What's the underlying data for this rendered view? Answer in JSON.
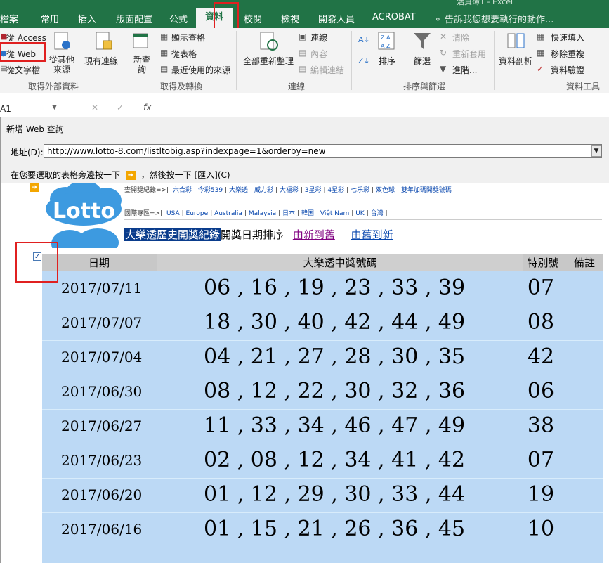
{
  "window": {
    "title_partial": "活頁簿1 - Excel"
  },
  "ribbon_tabs": [
    "檔案",
    "常用",
    "插入",
    "版面配置",
    "公式",
    "資料",
    "校閱",
    "檢視",
    "開發人員",
    "ACROBAT"
  ],
  "tell_me": "告訴我您想要執行的動作...",
  "ribbon": {
    "from_access": "從 Access",
    "from_web": "從 Web",
    "from_text": "從文字檔",
    "from_other": "從其他\n來源",
    "existing_connections": "現有連線",
    "get_external_group": "取得外部資料",
    "new_query": "新查\n詢",
    "show_queries": "顯示查格",
    "from_table": "從表格",
    "recent_sources": "最近使用的來源",
    "get_transform_group": "取得及轉換",
    "refresh_all": "全部重新整理",
    "connections": "連線",
    "properties": "內容",
    "edit_links": "編輯連結",
    "connections_group": "連線",
    "sort": "排序",
    "filter": "篩選",
    "clear": "清除",
    "reapply": "重新套用",
    "advanced": "進階...",
    "sort_filter_group": "排序與篩選",
    "text_to_columns": "資料剖析",
    "flash_fill": "快速填入",
    "remove_duplicates": "移除重複",
    "data_validation": "資料驗證",
    "data_tools_group": "資料工具"
  },
  "formula_bar": {
    "name_box": "A1",
    "fx": "fx"
  },
  "dialog": {
    "title": "新增 Web 查詢",
    "address_label": "地址(D):",
    "address_value": "http://www.lotto-8.com/listltobig.asp?indexpage=1&orderby=new",
    "instruction": "在您要選取的表格旁邊按一下",
    "instruction_2": "，然後按一下 [匯入](C)"
  },
  "webpage": {
    "logo_text": "Lotto",
    "nav1_label": "查開獎紀錄=>|",
    "nav1_items": [
      "六合彩",
      "今彩539",
      "大樂透",
      "威力彩",
      "大福彩",
      "3星彩",
      "4星彩",
      "七乐彩",
      "双色球",
      "雙年加碼開獎號碼"
    ],
    "nav2_label": "國際專區=>|",
    "nav2_items": [
      "USA",
      "Europe",
      "Australia",
      "Malaysia",
      "日本",
      "韓国",
      "Việt Nam",
      "UK",
      "台灣"
    ],
    "headline_highlight": "大樂透歷史開獎紀錄",
    "headline_text": "開獎日期排序",
    "sort_new_to_old": "由新到舊",
    "sort_old_to_new": "由舊到新",
    "table_headers": {
      "date": "日期",
      "numbers": "大樂透中獎號碼",
      "special": "特別號",
      "note": "備註"
    },
    "rows": [
      {
        "date": "2017/07/11",
        "numbers": "06 , 16 , 19 , 23 , 33 , 39",
        "special": "07"
      },
      {
        "date": "2017/07/07",
        "numbers": "18 , 30 , 40 , 42 , 44 , 49",
        "special": "08"
      },
      {
        "date": "2017/07/04",
        "numbers": "04 , 21 , 27 , 28 , 30 , 35",
        "special": "42"
      },
      {
        "date": "2017/06/30",
        "numbers": "08 , 12 , 22 , 30 , 32 , 36",
        "special": "06"
      },
      {
        "date": "2017/06/27",
        "numbers": "11 , 33 , 34 , 46 , 47 , 49",
        "special": "38"
      },
      {
        "date": "2017/06/23",
        "numbers": "02 , 08 , 12 , 34 , 41 , 42",
        "special": "07"
      },
      {
        "date": "2017/06/20",
        "numbers": "01 , 12 , 29 , 30 , 33 , 44",
        "special": "19"
      },
      {
        "date": "2017/06/16",
        "numbers": "01 , 15 , 21 , 26 , 36 , 45",
        "special": "10"
      }
    ]
  },
  "colors": {
    "excel_green": "#217346",
    "table_blue": "#bcd9f5",
    "highlight_red": "#e02020",
    "link_blue": "#0645ad"
  }
}
